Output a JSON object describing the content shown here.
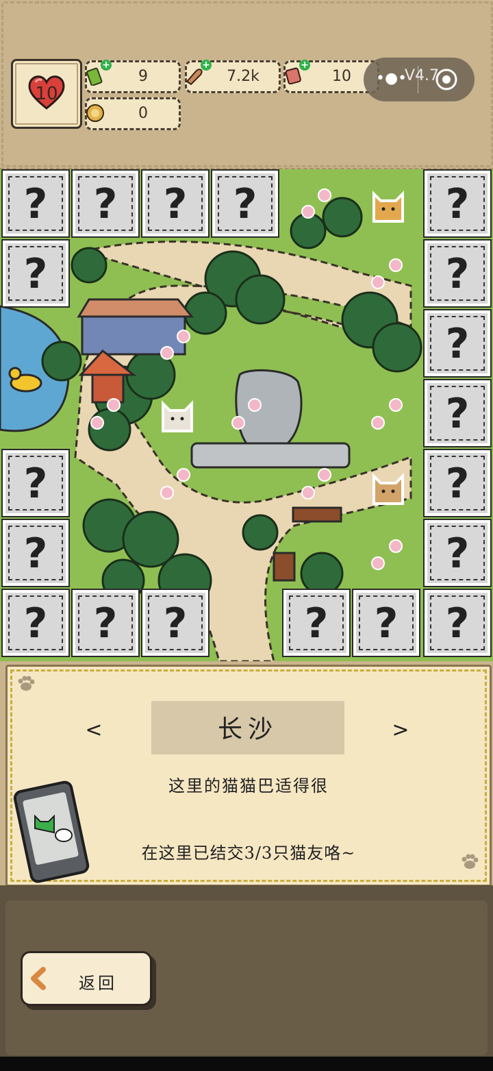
{
  "status": {
    "hearts": "10",
    "resources": [
      {
        "name": "green-ticket",
        "value": "9",
        "icon": "ticket-icon",
        "color": "#7ab83a"
      },
      {
        "name": "fish",
        "value": "7.2k",
        "icon": "fish-icon",
        "color": "#c9895d"
      },
      {
        "name": "snack",
        "value": "10",
        "icon": "snack-bag-icon",
        "color": "#d9756a"
      },
      {
        "name": "coin",
        "value": "0",
        "icon": "coin-icon",
        "color": "#e2b24a"
      }
    ]
  },
  "capsule": {
    "version": "V4.7"
  },
  "map": {
    "locked_tile_label": "?",
    "cats": [
      "white-cat-icon",
      "orange-cat-icon",
      "tan-cat-icon"
    ]
  },
  "panel": {
    "prev": "<",
    "next": ">",
    "city": "长沙",
    "description": "这里的猫猫巴适得很",
    "friends": "在这里已结交3/3只猫友咯~"
  },
  "footer": {
    "back_label": "返回"
  },
  "colors": {
    "heart": "#d9403a",
    "plus": "#2fb24a",
    "panel_bg": "#f6e7c3",
    "accent_dash": "#c8ad3e"
  }
}
